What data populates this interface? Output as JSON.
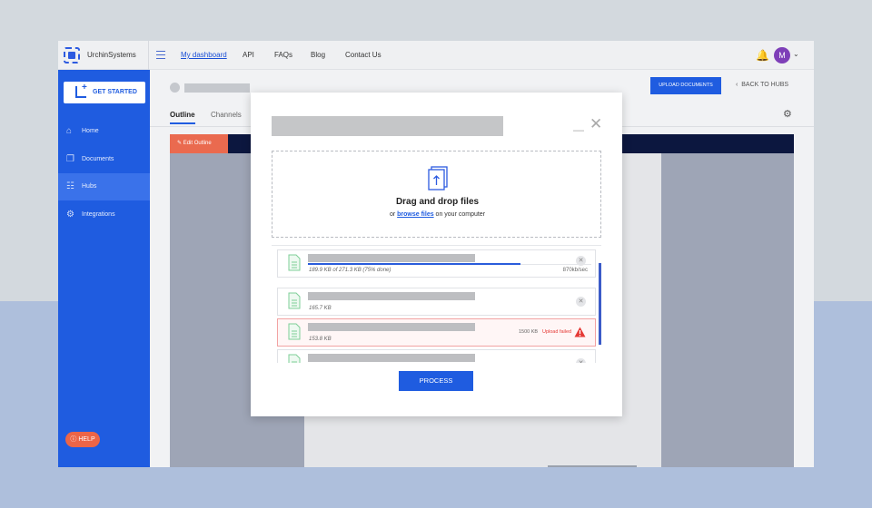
{
  "topbar": {
    "brand": "UrchinSystems",
    "nav": [
      "My dashboard",
      "API",
      "FAQs",
      "Blog",
      "Contact Us"
    ],
    "avatar_initial": "M"
  },
  "sidebar": {
    "get_started": "GET STARTED",
    "items": [
      {
        "label": "Home",
        "icon": "home-icon"
      },
      {
        "label": "Documents",
        "icon": "documents-icon"
      },
      {
        "label": "Hubs",
        "icon": "hubs-icon",
        "active": true
      },
      {
        "label": "Integrations",
        "icon": "integrations-icon"
      }
    ],
    "help": "HELP"
  },
  "content": {
    "upload_documents": "UPLOAD DOCUMENTS",
    "back_to_hubs": "BACK TO HUBS",
    "tabs": [
      "Outline",
      "Channels"
    ],
    "edit_outline": "Edit Outline"
  },
  "modal": {
    "drop_title": "Drag and drop files",
    "drop_prefix": "or ",
    "drop_link": "browse files",
    "drop_suffix": " on your computer",
    "files": [
      {
        "meta": "189.9 KB of 271.3 KB (75% done)",
        "speed": "870kb/sec",
        "progress": 0.75,
        "status": "uploading"
      },
      {
        "meta": "165.7 KB",
        "status": "done"
      },
      {
        "meta": "153.8 KB",
        "status": "failed",
        "size_limit": "1500 KB",
        "error": "Upload failed"
      },
      {
        "meta": "",
        "status": "done"
      }
    ],
    "process": "PROCESS"
  },
  "colors": {
    "primary": "#1f5ce0",
    "navy": "#0c173f",
    "accent_orange": "#ea6a4f",
    "error": "#e53935",
    "avatar": "#7e3fb8"
  }
}
